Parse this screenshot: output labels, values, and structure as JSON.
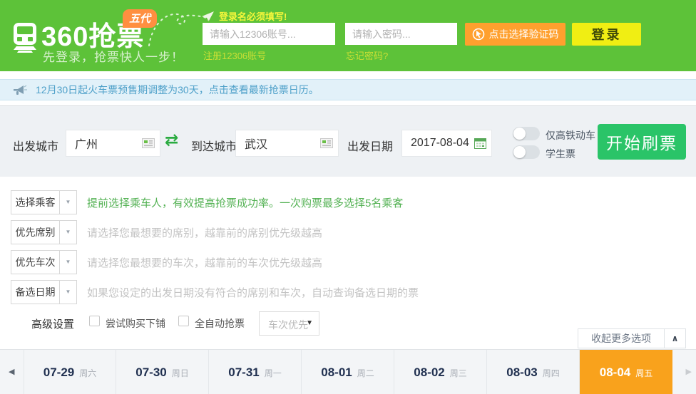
{
  "header": {
    "brand": {
      "title": "360抢票",
      "badge": "五代",
      "tagline": "先登录，抢票快人一步！"
    },
    "login": {
      "alert": "登录名必须填写!",
      "account_placeholder": "请输入12306账号...",
      "register_link": "注册12306账号",
      "password_placeholder": "请输入密码...",
      "forgot_link": "忘记密码?",
      "captcha_button": "点击选择验证码",
      "login_button": "登录"
    }
  },
  "notice": {
    "text": "12月30日起火车票预售期调整为30天，点击查看最新抢票日历。"
  },
  "search": {
    "from_label": "出发城市",
    "from_value": "广州",
    "to_label": "到达城市",
    "to_value": "武汉",
    "date_label": "出发日期",
    "date_value": "2017-08-04",
    "toggle_highspeed_label": "仅高铁动车",
    "toggle_student_label": "学生票",
    "start_button": "开始刷票"
  },
  "options": {
    "rows": [
      {
        "button": "选择乘客",
        "desc": "提前选择乘车人，有效提高抢票成功率。一次购票最多选择5名乘客"
      },
      {
        "button": "优先席别",
        "desc": "请选择您最想要的席别，越靠前的席别优先级越高"
      },
      {
        "button": "优先车次",
        "desc": "请选择您最想要的车次，越靠前的车次优先级越高"
      },
      {
        "button": "备选日期",
        "desc": "如果您设定的出发日期没有符合的席别和车次，自动查询备选日期的票"
      }
    ],
    "advanced": {
      "label": "高级设置",
      "checkbox_lower_berth": "尝试购买下铺",
      "checkbox_full_auto": "全自动抢票",
      "select_value": "车次优先"
    },
    "collapse_button": "收起更多选项"
  },
  "datebar": {
    "tabs": [
      {
        "date": "07-29",
        "day": "周六",
        "active": false
      },
      {
        "date": "07-30",
        "day": "周日",
        "active": false
      },
      {
        "date": "07-31",
        "day": "周一",
        "active": false
      },
      {
        "date": "08-01",
        "day": "周二",
        "active": false
      },
      {
        "date": "08-02",
        "day": "周三",
        "active": false
      },
      {
        "date": "08-03",
        "day": "周四",
        "active": false
      },
      {
        "date": "08-04",
        "day": "周五",
        "active": true
      }
    ]
  },
  "icons": {
    "swap": "⇄",
    "dropdown_arrow": "▼",
    "select_arrow": "▼",
    "collapse_chevron": "∧",
    "prev_arrow": "◀",
    "next_arrow": "▶"
  },
  "colors": {
    "brand-green": "#5dc239",
    "badge-orange": "#ff8f40",
    "alert-yellow": "#f8f73a",
    "link-yellow": "#cadf35",
    "captcha-orange": "#ffa02e",
    "login-yellow": "#f0ee13",
    "notice-bg": "#e2f1f9",
    "notice-text": "#4ea0c9",
    "panel-gray": "#eef1f4",
    "start-green": "#2ac468",
    "tip-green": "#54b254",
    "active-orange": "#f9a21c",
    "date-navy": "#203050"
  }
}
